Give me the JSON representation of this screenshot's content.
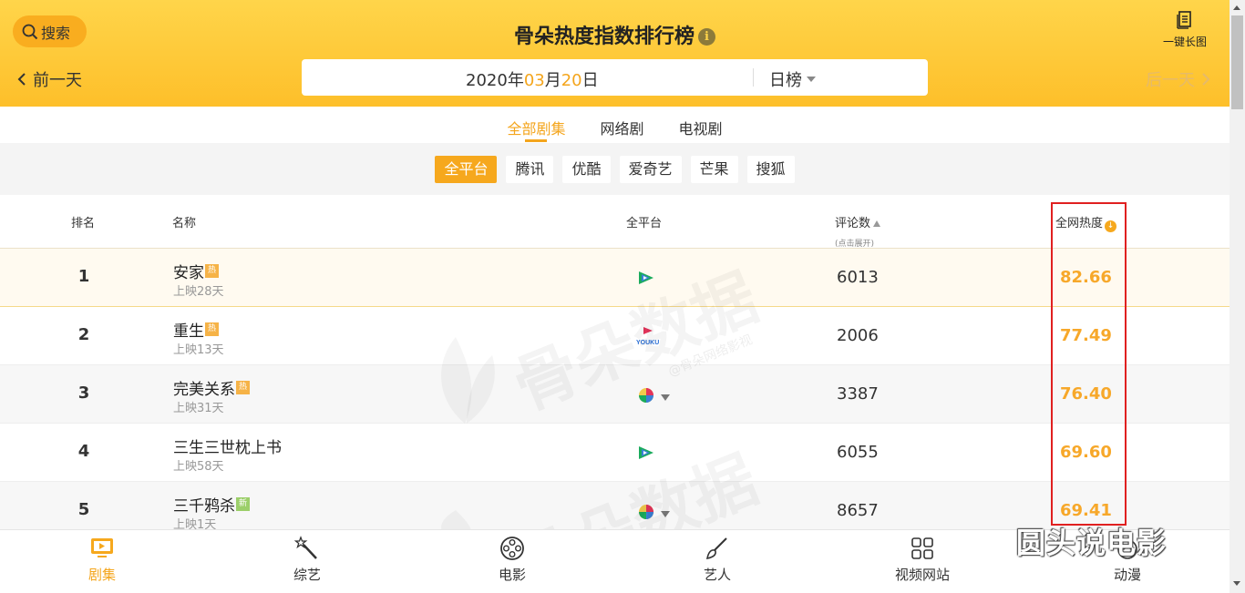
{
  "header": {
    "search_label": "搜索",
    "title": "骨朵热度指数排行榜",
    "info_glyph": "i",
    "long_image_label": "一键长图",
    "prev_day": "前一天",
    "next_day": "后一天",
    "date": {
      "year": "2020",
      "year_suffix": "年",
      "month": "03",
      "month_suffix": "月",
      "day": "20",
      "day_suffix": "日"
    },
    "rank_type": "日榜"
  },
  "tabs": [
    {
      "label": "全部剧集",
      "active": true
    },
    {
      "label": "网络剧",
      "active": false
    },
    {
      "label": "电视剧",
      "active": false
    }
  ],
  "platforms": [
    {
      "label": "全平台",
      "active": true
    },
    {
      "label": "腾讯",
      "active": false
    },
    {
      "label": "优酷",
      "active": false
    },
    {
      "label": "爱奇艺",
      "active": false
    },
    {
      "label": "芒果",
      "active": false
    },
    {
      "label": "搜狐",
      "active": false
    }
  ],
  "table_header": {
    "rank": "排名",
    "name": "名称",
    "platform": "全平台",
    "comments": "评论数",
    "comments_note": "(点击展开)",
    "heat": "全网热度"
  },
  "rows": [
    {
      "rank": "1",
      "name": "安家",
      "badge": "热",
      "badge_type": "hot",
      "days": "上映28天",
      "platform_icon": "tencent-video-icon",
      "comments": "6013",
      "heat": "82.66"
    },
    {
      "rank": "2",
      "name": "重生",
      "badge": "热",
      "badge_type": "hot",
      "days": "上映13天",
      "platform_icon": "youku-icon",
      "platform_text": "YOUKU",
      "comments": "2006",
      "heat": "77.49"
    },
    {
      "rank": "3",
      "name": "完美关系",
      "badge": "热",
      "badge_type": "hot",
      "days": "上映31天",
      "platform_icon": "multi-platform-icon",
      "comments": "3387",
      "heat": "76.40"
    },
    {
      "rank": "4",
      "name": "三生三世枕上书",
      "badge": "",
      "badge_type": "none",
      "days": "上映58天",
      "platform_icon": "tencent-video-icon",
      "comments": "6055",
      "heat": "69.60"
    },
    {
      "rank": "5",
      "name": "三千鸦杀",
      "badge": "新",
      "badge_type": "new",
      "days": "上映1天",
      "platform_icon": "multi-platform-icon",
      "comments": "8657",
      "heat": "69.41"
    }
  ],
  "watermark": {
    "brand": "骨朵数据",
    "sub": "@骨朵网络影视"
  },
  "bottom_nav": [
    {
      "label": "剧集",
      "icon": "tv-play-icon",
      "active": true
    },
    {
      "label": "综艺",
      "icon": "magic-wand-icon",
      "active": false
    },
    {
      "label": "电影",
      "icon": "film-reel-icon",
      "active": false
    },
    {
      "label": "艺人",
      "icon": "brush-icon",
      "active": false
    },
    {
      "label": "视频网站",
      "icon": "grid-apps-icon",
      "active": false
    },
    {
      "label": "动漫",
      "icon": "anime-icon",
      "active": false
    }
  ],
  "corner_watermark": "圆头说电影",
  "colors": {
    "accent": "#f4a51c",
    "header_bg": "#fdc93a",
    "heat_text": "#f7a82a",
    "highlight_box": "#e02020"
  }
}
